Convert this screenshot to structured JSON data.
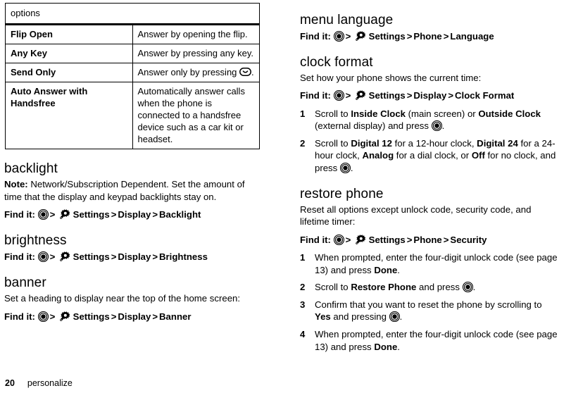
{
  "footer": {
    "page_number": "20",
    "section": "personalize"
  },
  "icons": {
    "center_key": "center-select-key-icon",
    "settings": "settings-gear-wrench-icon",
    "send_key": "send-key-icon"
  },
  "left_column": {
    "table": {
      "header": "options",
      "rows": [
        {
          "option": "Flip Open",
          "description_before": "Answer by opening the flip.",
          "icon": null,
          "description_after": ""
        },
        {
          "option": "Any Key",
          "description_before": "Answer by pressing any key.",
          "icon": null,
          "description_after": ""
        },
        {
          "option": "Send Only",
          "description_before": "Answer only by pressing ",
          "icon": "send_key",
          "description_after": "."
        },
        {
          "option": "Auto Answer with Handsfree",
          "description_before": "Automatically answer calls when the phone is connected to a handsfree device such as a car kit or headset.",
          "icon": null,
          "description_after": ""
        }
      ]
    },
    "sections": [
      {
        "heading": "backlight",
        "note_label": "Note:",
        "note_text": " Network/Subscription Dependent. Set the amount of time that the display and keypad backlights stay on.",
        "findit_label": "Find it:",
        "path": [
          "Settings",
          "Display",
          "Backlight"
        ]
      },
      {
        "heading": "brightness",
        "findit_label": "Find it:",
        "path": [
          "Settings",
          "Display",
          "Brightness"
        ]
      },
      {
        "heading": "banner",
        "body": "Set a heading to display near the top of the home screen:",
        "findit_label": "Find it:",
        "path": [
          "Settings",
          "Display",
          "Banner"
        ]
      }
    ]
  },
  "right_column": {
    "sections": [
      {
        "heading": "menu language",
        "findit_label": "Find it:",
        "path": [
          "Settings",
          "Phone",
          "Language"
        ]
      },
      {
        "heading": "clock format",
        "body": "Set how your phone shows the current time:",
        "findit_label": "Find it:",
        "path": [
          "Settings",
          "Display",
          "Clock Format"
        ],
        "steps": [
          {
            "num": "1",
            "parts": [
              {
                "t": "Scroll to "
              },
              {
                "t": "Inside Clock",
                "b": true
              },
              {
                "t": " (main screen) or "
              },
              {
                "t": "Outside Clock",
                "b": true
              },
              {
                "t": " (external display) and press "
              },
              {
                "icon": "center_key"
              },
              {
                "t": "."
              }
            ]
          },
          {
            "num": "2",
            "parts": [
              {
                "t": "Scroll to "
              },
              {
                "t": "Digital 12",
                "b": true
              },
              {
                "t": " for a 12-hour clock, "
              },
              {
                "t": "Digital 24",
                "b": true
              },
              {
                "t": " for a 24-hour clock, "
              },
              {
                "t": "Analog",
                "b": true
              },
              {
                "t": " for a dial clock, or "
              },
              {
                "t": "Off",
                "b": true
              },
              {
                "t": " for no clock, and press "
              },
              {
                "icon": "center_key"
              },
              {
                "t": "."
              }
            ]
          }
        ]
      },
      {
        "heading": "restore phone",
        "body": "Reset all options except unlock code, security code, and lifetime timer:",
        "findit_label": "Find it:",
        "path": [
          "Settings",
          "Phone",
          "Security"
        ],
        "steps": [
          {
            "num": "1",
            "parts": [
              {
                "t": "When prompted, enter the four-digit unlock code (see page 13) and press "
              },
              {
                "t": "Done",
                "b": true
              },
              {
                "t": "."
              }
            ]
          },
          {
            "num": "2",
            "parts": [
              {
                "t": "Scroll to "
              },
              {
                "t": "Restore Phone",
                "b": true
              },
              {
                "t": " and press "
              },
              {
                "icon": "center_key"
              },
              {
                "t": "."
              }
            ]
          },
          {
            "num": "3",
            "parts": [
              {
                "t": "Confirm that you want to reset the phone by scrolling to "
              },
              {
                "t": "Yes",
                "b": true
              },
              {
                "t": " and pressing "
              },
              {
                "icon": "center_key"
              },
              {
                "t": "."
              }
            ]
          },
          {
            "num": "4",
            "parts": [
              {
                "t": "When prompted, enter the four-digit unlock code (see page 13) and press "
              },
              {
                "t": "Done",
                "b": true
              },
              {
                "t": "."
              }
            ]
          }
        ]
      }
    ]
  }
}
